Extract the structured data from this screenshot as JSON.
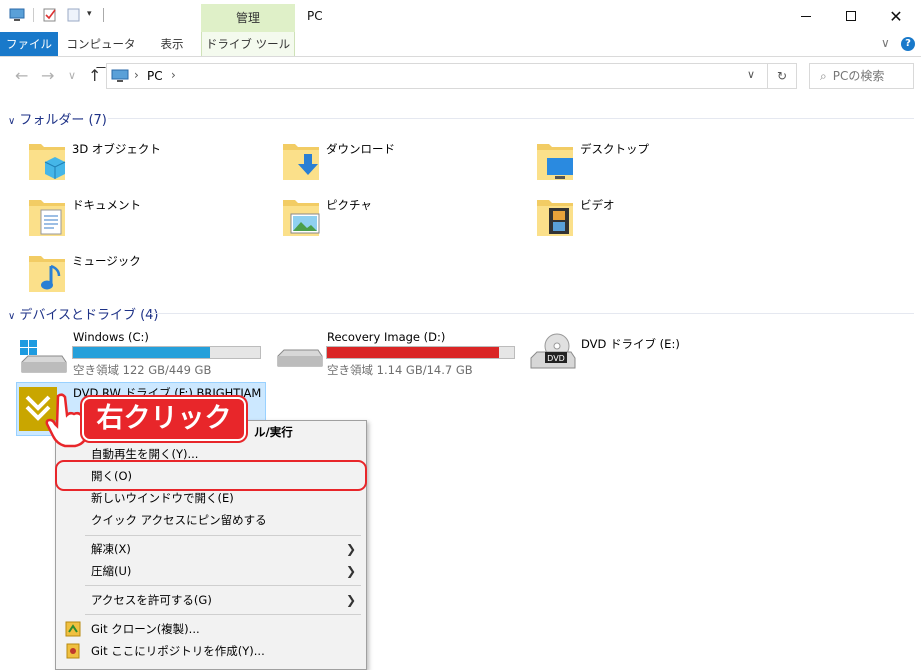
{
  "title_bar": {
    "context_tab": "管理",
    "window_title": "PC",
    "controls": [
      "minimize",
      "maximize",
      "close"
    ]
  },
  "ribbon": {
    "tabs": [
      "ファイル",
      "コンピューター",
      "表示",
      "ドライブ ツール"
    ]
  },
  "address": {
    "path_segment": "PC",
    "search_placeholder": "PCの検索"
  },
  "folders": {
    "header": "フォルダー (7)",
    "items": [
      {
        "label": "3D オブジェクト",
        "icon": "3d-objects-icon"
      },
      {
        "label": "ダウンロード",
        "icon": "downloads-icon"
      },
      {
        "label": "デスクトップ",
        "icon": "desktop-icon"
      },
      {
        "label": "ドキュメント",
        "icon": "documents-icon"
      },
      {
        "label": "ピクチャ",
        "icon": "pictures-icon"
      },
      {
        "label": "ビデオ",
        "icon": "videos-icon"
      },
      {
        "label": "ミュージック",
        "icon": "music-icon"
      }
    ]
  },
  "devices": {
    "header": "デバイスとドライブ (4)",
    "drives": [
      {
        "name": "Windows (C:)",
        "free": "空き領域 122 GB/449 GB",
        "used_fraction": 0.73,
        "color": "#26a0da"
      },
      {
        "name": "Recovery Image (D:)",
        "free": "空き領域 1.14 GB/14.7 GB",
        "used_fraction": 0.92,
        "color": "#da2626"
      },
      {
        "name": "DVD ドライブ (E:)"
      },
      {
        "name": "DVD RW ドライブ (F:) BRIGHTJAM"
      }
    ]
  },
  "context_menu": {
    "partial_top": "ル/実行",
    "items": [
      "自動再生を開く(Y)...",
      "開く(O)",
      "新しいウインドウで開く(E)",
      "クイック アクセスにピン留めする",
      "解凍(X)",
      "圧縮(U)",
      "アクセスを許可する(G)",
      "Git クローン(複製)...",
      "Git ここにリポジトリを作成(Y)..."
    ]
  },
  "annotation": {
    "callout": "右クリック",
    "accent": "#e8262a"
  }
}
